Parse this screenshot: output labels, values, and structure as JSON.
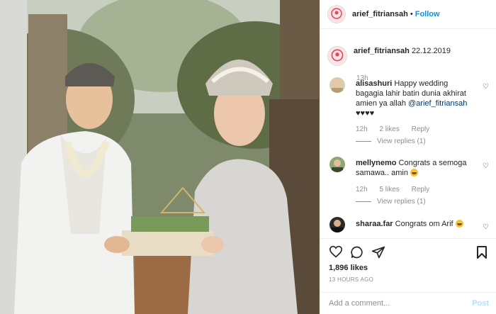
{
  "header": {
    "username": "arief_fitriansah",
    "separator": "•",
    "follow_label": "Follow"
  },
  "caption": {
    "username": "arief_fitriansah",
    "text": "22.12.2019",
    "time": "13h"
  },
  "comments": [
    {
      "username": "alisashuri",
      "text_before": "Happy wedding bagagia lahir batin dunia akhirat amien ya allah",
      "mention": "@arief_fitriansah",
      "text_after": "♥♥♥♥",
      "time": "12h",
      "likes": "2 likes",
      "reply": "Reply",
      "view_replies": "View replies (1)"
    },
    {
      "username": "mellynemo",
      "text": "Congrats a semoga samawa.. amin",
      "time": "12h",
      "likes": "5 likes",
      "reply": "Reply",
      "view_replies": "View replies (1)"
    },
    {
      "username": "sharaa.far",
      "text": "Congrats om Arif"
    }
  ],
  "actions": {
    "likes": "1,896 likes",
    "time_ago": "13 HOURS AGO",
    "comment_placeholder": "Add a comment...",
    "post_label": "Post"
  },
  "colors": {
    "accent": "#0095f6",
    "post_disabled": "#b2dffc",
    "muted": "#8e8e8e"
  }
}
